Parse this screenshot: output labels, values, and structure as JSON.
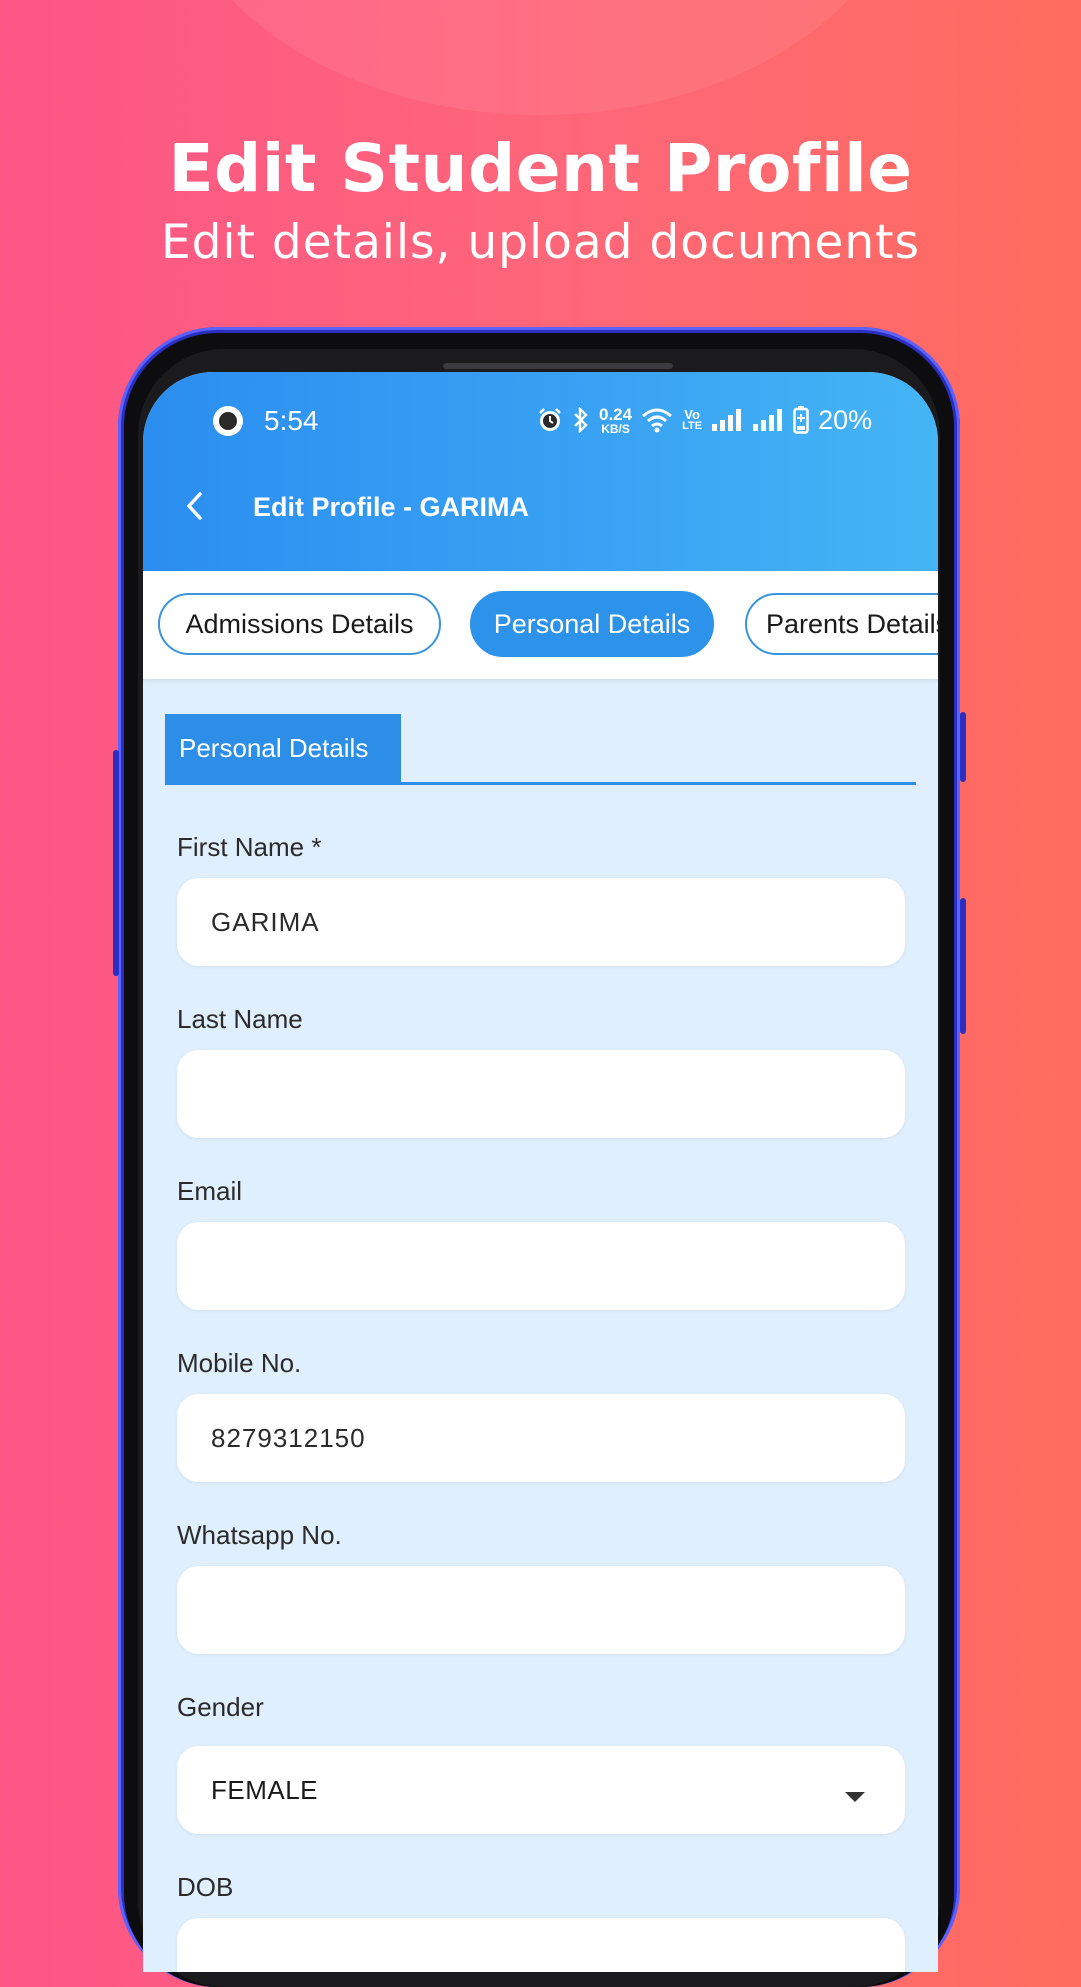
{
  "promo": {
    "title": "Edit Student Profile",
    "subtitle": "Edit details, upload documents"
  },
  "status_bar": {
    "time": "5:54",
    "net_speed_value": "0.24",
    "net_speed_unit": "KB/S",
    "volte_top": "Vo",
    "volte_bottom": "LTE",
    "battery": "20%"
  },
  "header": {
    "title": "Edit Profile - GARIMA"
  },
  "tabs": [
    {
      "label": "Admissions Details",
      "active": false
    },
    {
      "label": "Personal Details",
      "active": true
    },
    {
      "label": "Parents  Details",
      "active": false
    }
  ],
  "section": {
    "title": "Personal Details"
  },
  "form": {
    "first_name": {
      "label": "First Name *",
      "value": "GARIMA"
    },
    "last_name": {
      "label": "Last Name",
      "value": ""
    },
    "email": {
      "label": "Email",
      "value": ""
    },
    "mobile": {
      "label": "Mobile No.",
      "value": "8279312150"
    },
    "whatsapp": {
      "label": "Whatsapp No.",
      "value": ""
    },
    "gender": {
      "label": "Gender",
      "value": "FEMALE"
    },
    "dob": {
      "label": "DOB"
    }
  },
  "icons": [
    "camera-dot-icon",
    "alarm-icon",
    "bluetooth-icon",
    "wifi-icon",
    "signal-icon",
    "battery-icon",
    "back-arrow-icon",
    "dropdown-arrow-icon"
  ],
  "colors": {
    "header_gradient_start": "#2b8ef0",
    "header_gradient_end": "#45b5f5",
    "accent": "#2d8ee8",
    "form_background": "#e0effd",
    "background_left": "#fd5587",
    "background_right": "#ff6c5e"
  }
}
